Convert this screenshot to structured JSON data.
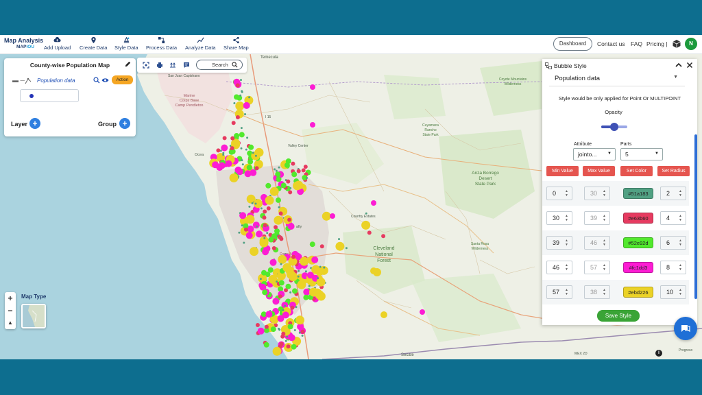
{
  "header": {
    "logo_main": "Map Analysis",
    "logo_sub_a": "MAP",
    "logo_sub_b": "IOU",
    "nav": [
      {
        "label": "Add Upload",
        "icon": "cloud-upload-icon"
      },
      {
        "label": "Create Data",
        "icon": "map-pin-icon"
      },
      {
        "label": "Style Data",
        "icon": "style-icon"
      },
      {
        "label": "Process Data",
        "icon": "process-icon"
      },
      {
        "label": "Analyze Data",
        "icon": "analyze-icon"
      },
      {
        "label": "Share Map",
        "icon": "share-icon"
      }
    ],
    "dashboard": "Dashboard",
    "contact": "Contact us",
    "faq": "FAQ",
    "pricing": "Pricing |",
    "avatar": "N"
  },
  "layer_panel": {
    "title": "County-wise Population Map",
    "layer_name": "Population data",
    "action": "Action",
    "layer_label": "Layer",
    "group_label": "Group",
    "legend_color": "#2433b7"
  },
  "toolbar": {
    "search": "Search"
  },
  "map_type": {
    "label": "Map Type"
  },
  "map_labels": {
    "temecula": "Temecula",
    "marine1": "Marine",
    "marine2": "Corps Base",
    "marine3": "Camp Pendleton",
    "sanjuan": "San Juan Capistrano",
    "oceanside": "Ocea",
    "valley_center": "Valley Center",
    "i15": "I 15",
    "anza1": "Anza Borrego",
    "anza2": "Desert",
    "anza3": "State Park",
    "cleveland1": "Cleveland",
    "cleveland2": "National",
    "cleveland3": "Forest",
    "country_estates": "Country Estates",
    "coyote1": "Coyote Mountains",
    "coyote2": "Wilderness",
    "cuyamaca1": "Cuyamaca",
    "cuyamaca2": "Rancho",
    "cuyamaca3": "State Park",
    "santa_rosa1": "Santa Rosa",
    "santa_rosa2": "Wilderness",
    "secate": "Secate",
    "progreso": "Progreso",
    "mex": "MEX 2D",
    "el": "Es",
    "ally": "ally",
    "corps1": "Corps Air",
    "corps2": "Station"
  },
  "bubble_style": {
    "title": "Bubble Style",
    "dataset": "Population data",
    "note": "Style would be only applied for Point Or MULTIPOINT",
    "opacity_label": "Opacity",
    "opacity": 0.5,
    "attribute_label": "Attribute",
    "attribute_value": "jointo...",
    "parts_label": "Parts",
    "parts_value": "5",
    "btn_min": "Min Value",
    "btn_max": "Max Value",
    "btn_color": "Set Color",
    "btn_radius": "Set Radius",
    "rows": [
      {
        "min": "0",
        "max": "30",
        "color": "#51a183",
        "radius": "2"
      },
      {
        "min": "30",
        "max": "39",
        "color": "#e63b60",
        "radius": "4"
      },
      {
        "min": "39",
        "max": "46",
        "color": "#52e92d",
        "radius": "6"
      },
      {
        "min": "46",
        "max": "57",
        "color": "#fc1dd3",
        "radius": "8"
      },
      {
        "min": "57",
        "max": "38",
        "color": "#ebd226",
        "radius": "10"
      }
    ],
    "save": "Save Style"
  },
  "colors": {
    "brand": "#1f3b6b",
    "accent_blue": "#2f7fe0",
    "save_green": "#3aa436",
    "header_red": "#e5554f",
    "frame_teal": "#0d6e8f"
  }
}
